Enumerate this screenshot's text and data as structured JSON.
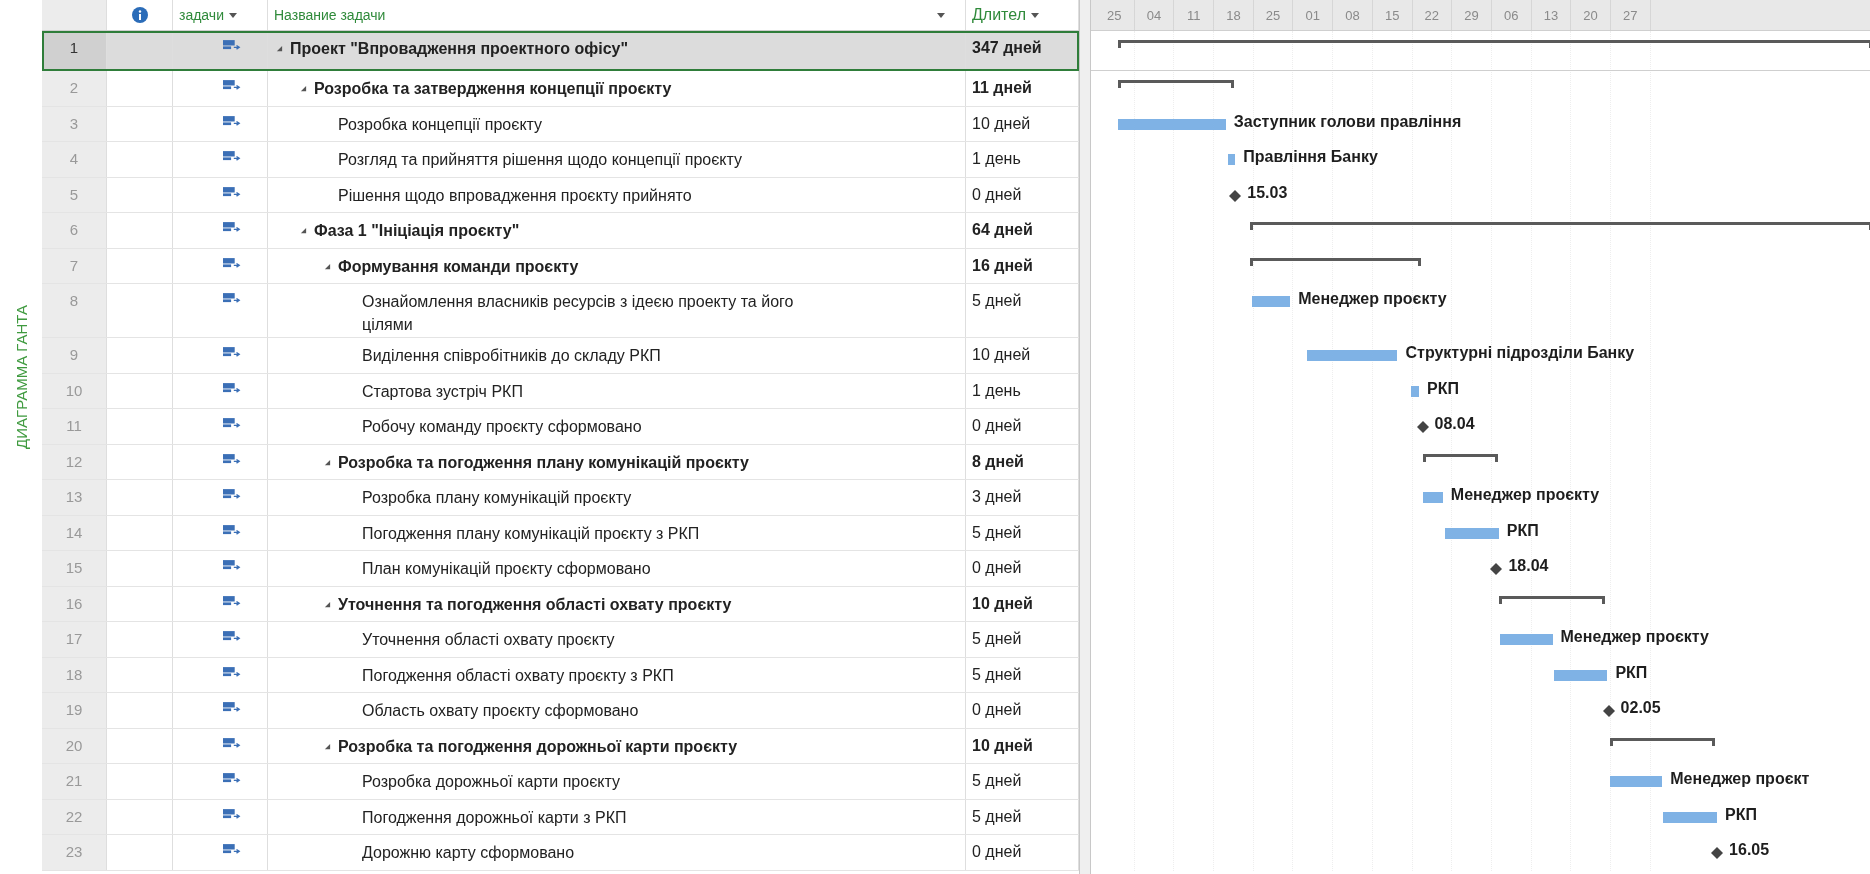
{
  "side_label": "ДИАГРАММА ГАНТА",
  "columns": [
    {
      "kind": "info"
    },
    {
      "kind": "mode",
      "label": "задачи"
    },
    {
      "kind": "name",
      "label": "Название задачи"
    },
    {
      "kind": "duration",
      "label": "Длител"
    }
  ],
  "timescale": [
    "25",
    "04",
    "11",
    "18",
    "25",
    "01",
    "08",
    "15",
    "22",
    "29",
    "06",
    "13",
    "20",
    "27"
  ],
  "tasks": [
    {
      "number": "1",
      "name": "Проект \"Впровадження проектного офісу\"",
      "duration": "347 дней",
      "kind": "summary",
      "expanded": true,
      "selected": true,
      "children": [
        {
          "number": "2",
          "name": "Розробка та затвердження концепції проєкту",
          "duration": "11 дней",
          "kind": "summary",
          "expanded": true,
          "selected": false,
          "children": [
            {
              "number": "3",
              "name": "Розробка концепції проєкту",
              "duration": "10 дней",
              "kind": "task",
              "selected": false,
              "bar_label": "Заступник голови правління"
            },
            {
              "number": "4",
              "name": "Розгляд та прийняття рішення щодо концепції проєкту",
              "duration": "1 день",
              "kind": "task",
              "selected": false,
              "bar_label": "Правління Банку"
            },
            {
              "number": "5",
              "name": "Рішення щодо впровадження проєкту прийнято",
              "duration": "0 дней",
              "kind": "milestone",
              "selected": false,
              "bar_label": "15.03"
            }
          ]
        },
        {
          "number": "6",
          "name": "Фаза 1 \"Ініціація проєкту\"",
          "duration": "64 дней",
          "kind": "summary",
          "expanded": true,
          "selected": false,
          "children": [
            {
              "number": "7",
              "name": "Формування команди проєкту",
              "duration": "16 дней",
              "kind": "summary",
              "expanded": true,
              "selected": false,
              "children": [
                {
                  "number": "8",
                  "name": "Ознайомлення власників ресурсів з ідеєю проекту та його цілями",
                  "duration": "5 дней",
                  "kind": "task",
                  "selected": false,
                  "bar_label": "Менеджер проєкту"
                },
                {
                  "number": "9",
                  "name": "Виділення співробітників до складу РКП",
                  "duration": "10 дней",
                  "kind": "task",
                  "selected": false,
                  "bar_label": "Структурні підрозділи Банку"
                },
                {
                  "number": "10",
                  "name": "Стартова зустріч РКП",
                  "duration": "1 день",
                  "kind": "task",
                  "selected": false,
                  "bar_label": "РКП"
                },
                {
                  "number": "11",
                  "name": "Робочу команду проєкту сформовано",
                  "duration": "0 дней",
                  "kind": "milestone",
                  "selected": false,
                  "bar_label": "08.04"
                }
              ]
            },
            {
              "number": "12",
              "name": "Розробка та погодження плану комунікацій проєкту",
              "duration": "8 дней",
              "kind": "summary",
              "expanded": true,
              "selected": false,
              "children": [
                {
                  "number": "13",
                  "name": "Розробка плану комунікацій проєкту",
                  "duration": "3 дней",
                  "kind": "task",
                  "selected": false,
                  "bar_label": "Менеджер проєкту"
                },
                {
                  "number": "14",
                  "name": "Погодження плану комунікацій проєкту з РКП",
                  "duration": "5 дней",
                  "kind": "task",
                  "selected": false,
                  "bar_label": "РКП"
                },
                {
                  "number": "15",
                  "name": "План комунікацій проєкту сформовано",
                  "duration": "0 дней",
                  "kind": "milestone",
                  "selected": false,
                  "bar_label": "18.04"
                }
              ]
            },
            {
              "number": "16",
              "name": "Уточнення та погодження області охвату проєкту",
              "duration": "10 дней",
              "kind": "summary",
              "expanded": true,
              "selected": false,
              "children": [
                {
                  "number": "17",
                  "name": "Уточнення області охвату проєкту",
                  "duration": "5 дней",
                  "kind": "task",
                  "selected": false,
                  "bar_label": "Менеджер проєкту"
                },
                {
                  "number": "18",
                  "name": "Погодження області охвату проєкту з РКП",
                  "duration": "5 дней",
                  "kind": "task",
                  "selected": false,
                  "bar_label": "РКП"
                },
                {
                  "number": "19",
                  "name": "Область охвату проєкту сформовано",
                  "duration": "0 дней",
                  "kind": "milestone",
                  "selected": false,
                  "bar_label": "02.05"
                }
              ]
            },
            {
              "number": "20",
              "name": "Розробка та погодження дорожньої карти проєкту",
              "duration": "10 дней",
              "kind": "summary",
              "expanded": true,
              "selected": false,
              "children": [
                {
                  "number": "21",
                  "name": "Розробка дорожньої карти проєкту",
                  "duration": "5 дней",
                  "kind": "task",
                  "selected": false,
                  "bar_label": "Менеджер проєкт"
                },
                {
                  "number": "22",
                  "name": "Погодження дорожньої карти з РКП",
                  "duration": "5 дней",
                  "kind": "task",
                  "selected": false,
                  "bar_label": "РКП"
                },
                {
                  "number": "23",
                  "name": "Дорожню карту сформовано",
                  "duration": "0 дней",
                  "kind": "milestone",
                  "selected": false,
                  "bar_label": "16.05"
                }
              ]
            }
          ]
        }
      ]
    }
  ]
}
